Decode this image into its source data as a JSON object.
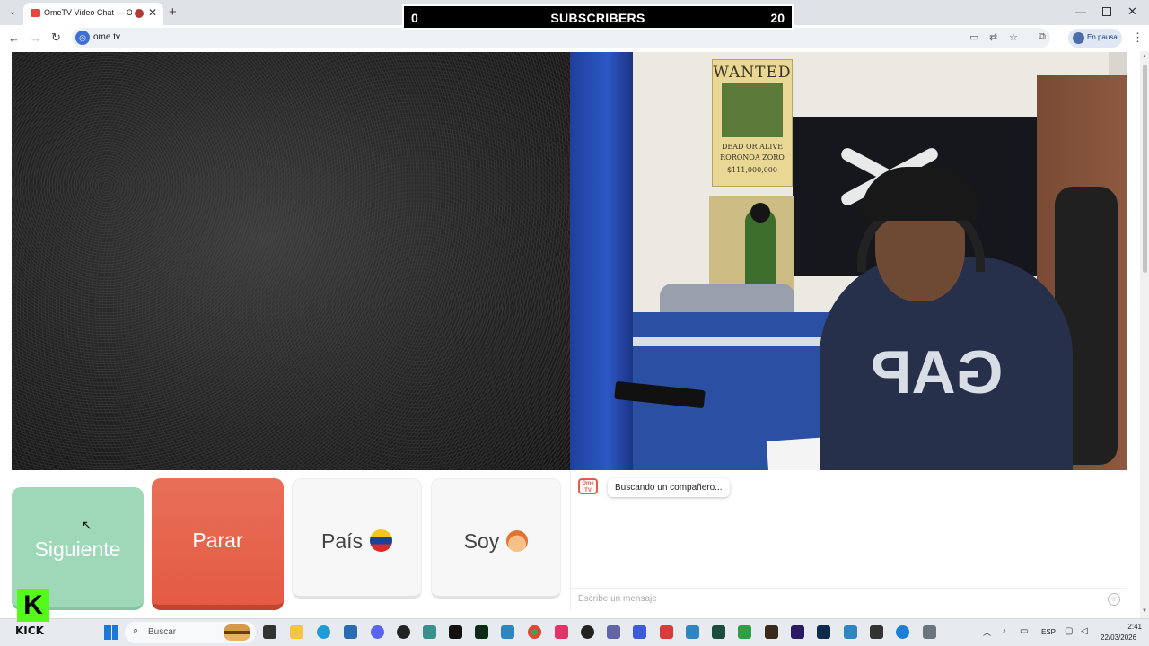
{
  "browser": {
    "tab_title": "OmeTV Video Chat — Ome",
    "new_tab_icon": "+",
    "url": "ome.tv",
    "paused_label": "En pausa"
  },
  "overlay": {
    "left_count": "0",
    "label": "SUBSCRIBERS",
    "right_count": "20"
  },
  "poster": {
    "top": "WANTED",
    "line1": "DEAD OR ALIVE",
    "line2": "RORONOA ZORO",
    "line3": "$111,000,000"
  },
  "shirt_print": "GAP",
  "controls": {
    "next_label": "Siguiente",
    "stop_label": "Parar",
    "country_label": "País",
    "gender_label": "Soy"
  },
  "chat": {
    "logo_text": "Ome TV",
    "status_message": "Buscando un compañero...",
    "input_placeholder": "Escribe un mensaje"
  },
  "overlay_logo": {
    "letter": "K",
    "text": "KICK"
  },
  "taskbar": {
    "search_placeholder": "Buscar",
    "language": "ESP",
    "time": "2:41",
    "date": "22/03/2026"
  },
  "colors": {
    "next_button": "#9fd8b9",
    "stop_button": "#e45b44",
    "kick_green": "#53fc18",
    "ome_red": "#ea5a46"
  }
}
